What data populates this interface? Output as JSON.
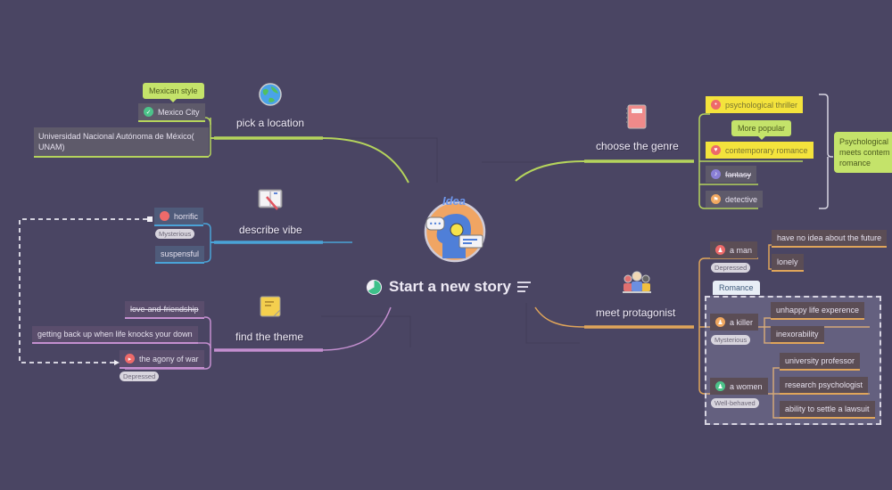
{
  "root": {
    "title": "Start a new story",
    "badge_text": "Idea",
    "icon": "idea-head-lightbulb-icon",
    "progress_icon": "progress-pie-icon",
    "notes_icon": "notes-lines-icon"
  },
  "branches": {
    "location": {
      "label": "pick a location",
      "icon": "globe-icon",
      "color": "#b5d45c",
      "callout": "Mexican style",
      "children": [
        {
          "text": "Mexico City",
          "marker": "check-icon",
          "marker_color": "#4cc38a"
        },
        {
          "text_line1": "Universidad Nacional Autónoma de México(",
          "text_line2": "UNAM)"
        }
      ]
    },
    "vibe": {
      "label": "describe vibe",
      "icon": "open-book-pencil-icon",
      "color": "#4aa3d8",
      "children": [
        {
          "text": "horrific",
          "marker": "red-circle-icon",
          "marker_color": "#ee6a6a"
        },
        {
          "text": "suspensful"
        }
      ],
      "tag": "Mysterious"
    },
    "theme": {
      "label": "find the theme",
      "icon": "sticky-note-icon",
      "color": "#c48fd0",
      "children": [
        {
          "text": "love-and-friendship",
          "strikethrough": true
        },
        {
          "text": "getting back up when life knocks your down"
        },
        {
          "text": "the agony of war",
          "marker": "play-icon",
          "marker_color": "#ee6a6a"
        }
      ],
      "tag": "Depressed"
    },
    "genre": {
      "label": "choose the genre",
      "icon": "notebook-icon",
      "color": "#b5d45c",
      "callout": "More popular",
      "children": [
        {
          "text": "psychological thriller",
          "marker": "red-circle-icon",
          "marker_color": "#ee6a6a",
          "highlighted": true
        },
        {
          "text": "contemporary romance",
          "marker": "heart-icon",
          "marker_color": "#ee6a6a",
          "highlighted": true
        },
        {
          "text": "fantasy",
          "marker": "music-note-icon",
          "marker_color": "#8a7fd6",
          "strikethrough": true
        },
        {
          "text": "detective",
          "marker": "flag-icon",
          "marker_color": "#f0a860"
        }
      ],
      "summary": "Psychological thriller meets contemporary romance",
      "summary_visible_lines": [
        "Psychological",
        "meets contem",
        "romance"
      ]
    },
    "protagonist": {
      "label": "meet protagonist",
      "icon": "group-people-icon",
      "color": "#e0a55a",
      "boundary_label": "Romance",
      "children": [
        {
          "text": "a man",
          "marker": "person-red-icon",
          "marker_color": "#ee6a6a",
          "tag": "Depressed",
          "children": [
            "have no idea about the future",
            "lonely"
          ]
        },
        {
          "text": "a killer",
          "marker": "person-orange-icon",
          "marker_color": "#f0a860",
          "tag": "Mysterious",
          "children": [
            "unhappy life experence",
            "inexorability"
          ]
        },
        {
          "text": "a women",
          "marker": "person-green-icon",
          "marker_color": "#4cc38a",
          "tag": "Well-behaved",
          "children": [
            "university professor",
            "research psychologist",
            "ability to settle a lawsuit"
          ]
        }
      ]
    }
  },
  "relationship": {
    "from": "the agony of war",
    "to": "horrific",
    "style": "dashed"
  }
}
